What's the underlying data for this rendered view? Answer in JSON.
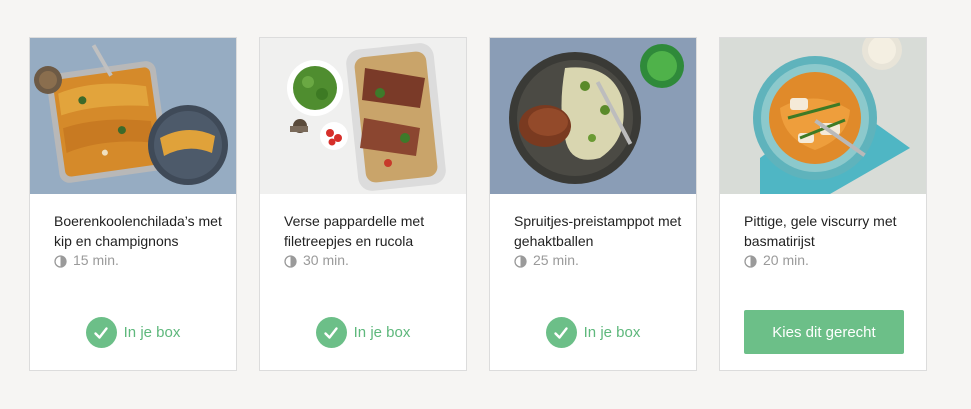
{
  "colors": {
    "accent": "#6cbf88",
    "accent_text": "#5eb87c",
    "background": "#f6f5f3",
    "muted_text": "#9a9a9a"
  },
  "recipes": [
    {
      "title": "Boerenkoolenchilada’s met kip en champignons",
      "time": "15 min.",
      "status": "in_box",
      "status_label": "In je box",
      "image": "chicken-enchilada-dish-photo"
    },
    {
      "title": "Verse pappardelle met filetreepjes en rucola",
      "time": "30 min.",
      "status": "in_box",
      "status_label": "In je box",
      "image": "pappardelle-steak-photo"
    },
    {
      "title": "Spruitjes-preistamppot met gehaktballen",
      "time": "25 min.",
      "status": "in_box",
      "status_label": "In je box",
      "image": "stamppot-meatball-photo"
    },
    {
      "title": "Pittige, gele viscurry met basmatirijst",
      "time": "20 min.",
      "status": "available",
      "button_label": "Kies dit gerecht",
      "image": "fish-curry-photo"
    }
  ]
}
